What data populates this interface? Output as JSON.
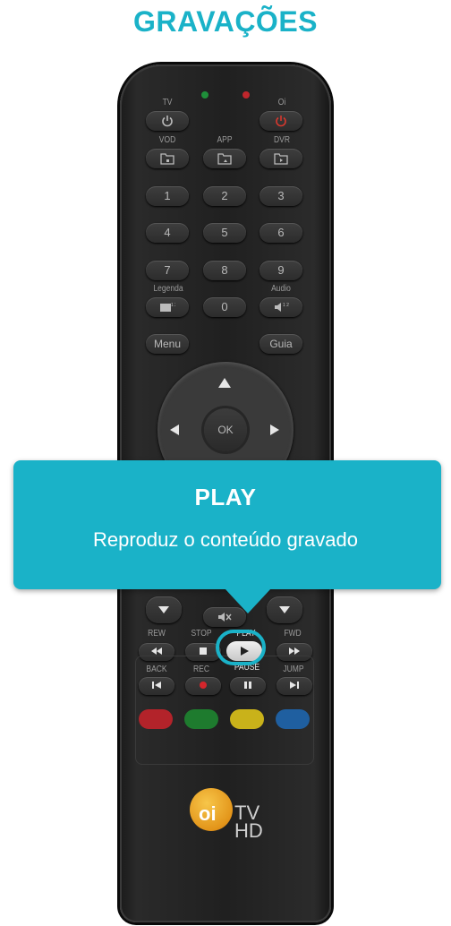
{
  "title": "GRAVAÇÕES",
  "remote": {
    "labels": {
      "tv": "TV",
      "oi": "Oi",
      "vod": "VOD",
      "app": "APP",
      "dvr": "DVR",
      "legenda": "Legenda",
      "audio": "Audio",
      "rew": "REW",
      "stop": "STOP",
      "play": "PLAY",
      "fwd": "FWD",
      "back": "BACK",
      "rec": "REC",
      "pause": "PAUSE",
      "jump": "JUMP"
    },
    "digits": [
      "1",
      "2",
      "3",
      "4",
      "5",
      "6",
      "7",
      "8",
      "9"
    ],
    "zero": "0",
    "menu": "Menu",
    "guia": "Guia",
    "ok": "OK",
    "logo_brand": "oi",
    "logo_tv": "TV",
    "logo_hd": "HD"
  },
  "tooltip": {
    "title": "PLAY",
    "text": "Reproduz o conteúdo gravado"
  },
  "colors": {
    "accent": "#1ab2c8",
    "red": "#b3232a",
    "green": "#1e7b2e",
    "yellow": "#c9b21a",
    "blue": "#1f5fa0"
  }
}
